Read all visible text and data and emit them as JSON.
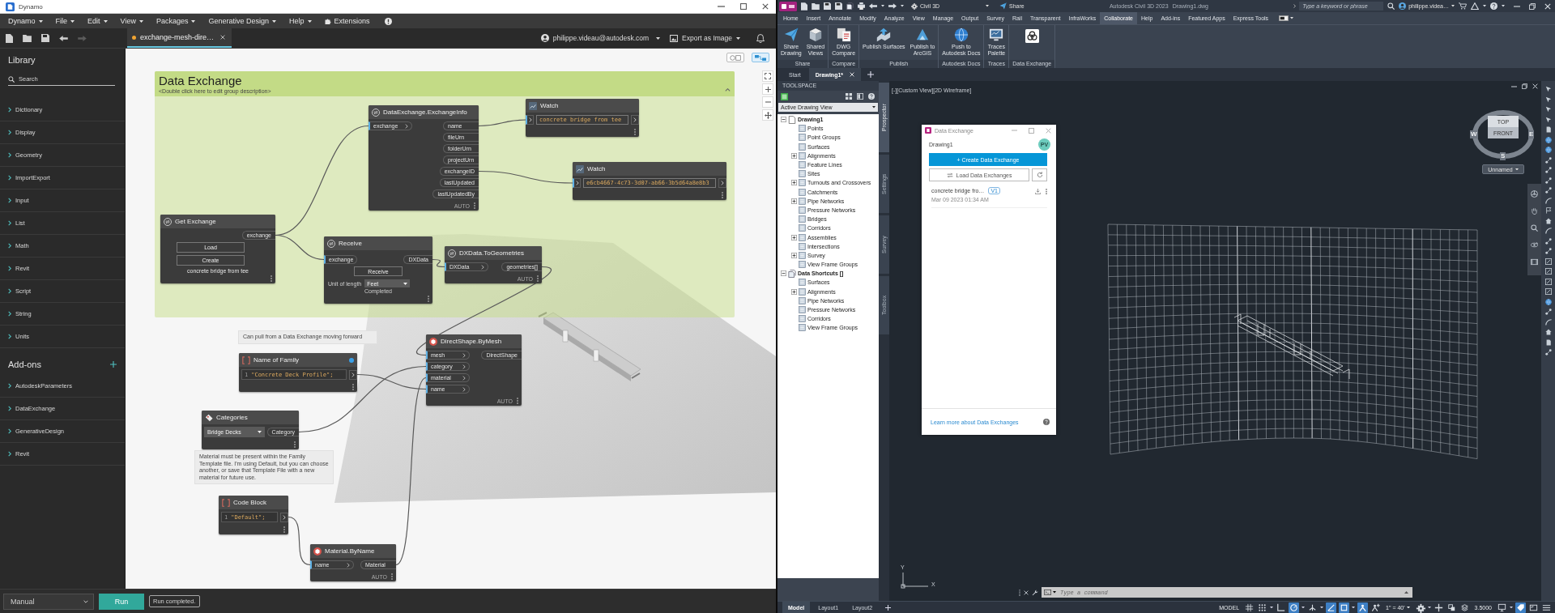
{
  "dynamo": {
    "window": {
      "title": "Dynamo"
    },
    "menu": [
      {
        "kind": "menu",
        "label": "Dynamo"
      },
      {
        "kind": "menu",
        "label": "File"
      },
      {
        "kind": "menu",
        "label": "Edit"
      },
      {
        "kind": "menu",
        "label": "View"
      },
      {
        "kind": "menu",
        "label": "Packages"
      },
      {
        "kind": "menu",
        "label": "Generative Design"
      },
      {
        "kind": "menu",
        "label": "Help"
      },
      {
        "kind": "extensions",
        "label": "Extensions"
      }
    ],
    "toolbar": [
      {
        "kind": "new",
        "disabled": false
      },
      {
        "kind": "open",
        "disabled": false
      },
      {
        "kind": "save",
        "disabled": false
      },
      {
        "kind": "undo",
        "disabled": false
      },
      {
        "kind": "redo",
        "disabled": true
      }
    ],
    "file_tab": {
      "label": "exchange-mesh-dire…",
      "unsaved": true
    },
    "account": "philippe.videau@autodesk.com",
    "export_button": "Export as Image",
    "library": {
      "title": "Library",
      "search": {
        "placeholder": "Search"
      },
      "items": [
        "Dictionary",
        "Display",
        "Geometry",
        "ImportExport",
        "Input",
        "List",
        "Math",
        "Revit",
        "Script",
        "String",
        "Units"
      ],
      "addons_title": "Add-ons",
      "addons": [
        "AutodeskParameters",
        "DataExchange",
        "GenerativeDesign",
        "Revit"
      ]
    },
    "view_toggles": [
      {
        "kind": "geometry",
        "selected": false
      },
      {
        "kind": "graph",
        "selected": true
      }
    ],
    "graph": {
      "group": {
        "title": "Data Exchange",
        "description": "<Double click here to edit group description>"
      },
      "nodes": [
        {
          "kind": "function",
          "title": "DataExchange.ExchangeInfo",
          "inputs": [
            {
              "label": "exchange",
              "connected": true
            }
          ],
          "outputs": [
            "name",
            "fileUrn",
            "folderUrn",
            "projectUrn",
            "exchangeID",
            "lastUpdated",
            "lastUpdatedBy"
          ],
          "lacing": "AUTO",
          "is_input": false
        },
        {
          "kind": "watch",
          "title": "Watch",
          "value": "concrete bridge from tee",
          "connected": true,
          "is_input": false
        },
        {
          "kind": "watch",
          "title": "Watch",
          "value": "e6cb4667-4c73-3d07-ab66-3b5d64a8e8b3",
          "connected": true,
          "is_input": false
        },
        {
          "kind": "get_exchange",
          "title": "Get Exchange",
          "outputs": [
            "exchange"
          ],
          "buttons": [
            "Load",
            "Create"
          ],
          "caption": "concrete bridge from tee",
          "is_input": false
        },
        {
          "kind": "receive",
          "title": "Receive",
          "inputs": [
            {
              "label": "exchange",
              "connected": true
            }
          ],
          "outputs": [
            "DXData"
          ],
          "button": "Receive",
          "unit_label": "Unit of length",
          "unit": "Feet",
          "status": "Completed",
          "is_input": false
        },
        {
          "kind": "function",
          "title": "DXData.ToGeometries",
          "inputs": [
            {
              "label": "DXData",
              "connected": true
            }
          ],
          "outputs": [
            "geometries[]"
          ],
          "lacing": "AUTO",
          "is_input": false
        },
        {
          "kind": "function",
          "title": "DirectShape.ByMesh",
          "inputs": [
            {
              "label": "mesh",
              "connected": true
            },
            {
              "label": "category",
              "connected": true
            },
            {
              "label": "material",
              "connected": true
            },
            {
              "label": "name",
              "connected": true
            }
          ],
          "outputs": [
            "DirectShape"
          ],
          "lacing": "AUTO",
          "is_input": false
        },
        {
          "kind": "code",
          "title": "Name of Family",
          "lines": [
            {
              "number": "1",
              "code": "\"Concrete Deck Profile\";"
            }
          ],
          "is_input": true
        },
        {
          "kind": "dropdown",
          "title": "Categories",
          "value": "Bridge Decks",
          "outputs": [
            "Category"
          ],
          "is_input": false
        },
        {
          "kind": "code",
          "title": "Code Block",
          "lines": [
            {
              "number": "1",
              "code": "\"Default\";"
            }
          ],
          "is_input": false
        },
        {
          "kind": "function",
          "title": "Material.ByName",
          "inputs": [
            {
              "label": "name",
              "connected": true
            }
          ],
          "outputs": [
            "Material"
          ],
          "lacing": "AUTO",
          "is_input": false
        }
      ],
      "notes": [
        {
          "text": "Can pull from a Data Exchange moving forward"
        },
        {
          "text": "Material must be present within the Family Template file. I'm using Default, but you can choose another, or save that Template File with a new material for future use."
        }
      ]
    },
    "run_mode": "Manual",
    "run_button": "Run",
    "run_status": "Run completed."
  },
  "civil3d": {
    "title_bar": {
      "workspace": "Civil 3D",
      "share": "Share",
      "title": "Autodesk Civil 3D 2023",
      "file": "Drawing1.dwg",
      "search": {
        "placeholder": "Type a keyword or phrase"
      },
      "user": "philippe.videa…"
    },
    "ribbon_tabs": [
      {
        "label": "Home",
        "selected": false
      },
      {
        "label": "Insert",
        "selected": false
      },
      {
        "label": "Annotate",
        "selected": false
      },
      {
        "label": "Modify",
        "selected": false
      },
      {
        "label": "Analyze",
        "selected": false
      },
      {
        "label": "View",
        "selected": false
      },
      {
        "label": "Manage",
        "selected": false
      },
      {
        "label": "Output",
        "selected": false
      },
      {
        "label": "Survey",
        "selected": false
      },
      {
        "label": "Rail",
        "selected": false
      },
      {
        "label": "Transparent",
        "selected": false
      },
      {
        "label": "InfraWorks",
        "selected": false
      },
      {
        "label": "Collaborate",
        "selected": true
      },
      {
        "label": "Help",
        "selected": false
      },
      {
        "label": "Add-ins",
        "selected": false
      },
      {
        "label": "Featured Apps",
        "selected": false
      },
      {
        "label": "Express Tools",
        "selected": false
      }
    ],
    "ribbon_panels": [
      {
        "label": "Share",
        "buttons": [
          {
            "kind": "share",
            "label": "Share\nDrawing"
          },
          {
            "kind": "views",
            "label": "Shared\nViews"
          }
        ]
      },
      {
        "label": "Compare",
        "buttons": [
          {
            "kind": "compare",
            "label": "DWG\nCompare"
          }
        ]
      },
      {
        "label": "Publish",
        "buttons": [
          {
            "kind": "surfaces",
            "label": "Publish Surfaces"
          },
          {
            "kind": "arcgis",
            "label": "Publish to\nArcGIS"
          }
        ]
      },
      {
        "label": "Autodesk Docs",
        "buttons": [
          {
            "kind": "docs",
            "label": "Push to\nAutodesk Docs"
          }
        ]
      },
      {
        "label": "Traces",
        "buttons": [
          {
            "kind": "traces",
            "label": "Traces\nPalette"
          }
        ]
      },
      {
        "label": "Data Exchange",
        "buttons": [
          {
            "kind": "exchange"
          }
        ]
      }
    ],
    "file_tabs": [
      {
        "label": "Start",
        "selected": false
      },
      {
        "label": "Drawing1*",
        "selected": true
      }
    ],
    "toolspace": {
      "title": "TOOLSPACE",
      "view": "Active Drawing View",
      "tree": [
        {
          "label": "Drawing1",
          "expanded": true,
          "children": [
            {
              "label": "Points",
              "expandable": false
            },
            {
              "label": "Point Groups",
              "expandable": false
            },
            {
              "label": "Surfaces",
              "expandable": false
            },
            {
              "label": "Alignments",
              "expandable": true
            },
            {
              "label": "Feature Lines",
              "expandable": false
            },
            {
              "label": "Sites",
              "expandable": false
            },
            {
              "label": "Turnouts and Crossovers",
              "expandable": true
            },
            {
              "label": "Catchments",
              "expandable": false
            },
            {
              "label": "Pipe Networks",
              "expandable": true
            },
            {
              "label": "Pressure Networks",
              "expandable": false
            },
            {
              "label": "Bridges",
              "expandable": false
            },
            {
              "label": "Corridors",
              "expandable": false
            },
            {
              "label": "Assemblies",
              "expandable": true
            },
            {
              "label": "Intersections",
              "expandable": false
            },
            {
              "label": "Survey",
              "expandable": true
            },
            {
              "label": "View Frame Groups",
              "expandable": false
            }
          ]
        },
        {
          "label": "Data Shortcuts []",
          "expanded": true,
          "children": [
            {
              "label": "Surfaces",
              "expandable": false
            },
            {
              "label": "Alignments",
              "expandable": true
            },
            {
              "label": "Pipe Networks",
              "expandable": false
            },
            {
              "label": "Pressure Networks",
              "expandable": false
            },
            {
              "label": "Corridors",
              "expandable": false
            },
            {
              "label": "View Frame Groups",
              "expandable": false
            }
          ]
        }
      ],
      "side_tabs": [
        {
          "label": "Prospector",
          "selected": true
        },
        {
          "label": "Settings",
          "selected": false
        },
        {
          "label": "Survey",
          "selected": false
        },
        {
          "label": "Toolbox",
          "selected": false
        }
      ]
    },
    "viewport": {
      "label": "[-][Custom View][2D Wireframe]",
      "viewcube": {
        "faces": [
          "TOP",
          "FRONT"
        ],
        "compass": [
          "W",
          "E",
          "S"
        ],
        "view_name": "Unnamed"
      }
    },
    "data_exchange": {
      "title": "Data Exchange",
      "drawing": "Drawing1",
      "avatar": "PV",
      "create_button": "+ Create Data Exchange",
      "load_button": "Load Data Exchanges",
      "exchanges": [
        {
          "name": "concrete bridge fro…",
          "version": "V1",
          "date": "Mar 09 2023 01:34 AM"
        }
      ],
      "footer_link": "Learn more about Data Exchanges"
    },
    "ucs": {
      "x_label": "X",
      "y_label": "Y"
    },
    "command_line": {
      "placeholder": "Type a command"
    },
    "layout_tabs": [
      {
        "label": "Model",
        "selected": true
      },
      {
        "label": "Layout1",
        "selected": false
      },
      {
        "label": "Layout2",
        "selected": false
      }
    ],
    "status_bar": {
      "mode": "MODEL",
      "toggles": [
        {
          "kind": "grid",
          "on": false
        },
        {
          "kind": "snap",
          "on": false
        },
        {
          "kind": "ortho",
          "on": false
        },
        {
          "kind": "polar",
          "on": true
        },
        {
          "kind": "isodraft",
          "on": false
        },
        {
          "kind": "tracking",
          "on": true
        },
        {
          "kind": "osnap",
          "on": true
        },
        {
          "kind": "annovis",
          "on": true
        },
        {
          "kind": "autoscale",
          "on": false
        }
      ],
      "scale": "1\" = 40'",
      "tools": [
        {
          "kind": "gear",
          "on": false
        },
        {
          "kind": "plus",
          "on": false
        },
        {
          "kind": "isolate",
          "on": false
        },
        {
          "kind": "layers",
          "on": false
        }
      ],
      "value": "3.5000",
      "tools_end": [
        {
          "kind": "monitor",
          "on": false
        },
        {
          "kind": "tag",
          "on": true
        },
        {
          "kind": "fullscreen",
          "on": false
        },
        {
          "kind": "menu",
          "on": false
        }
      ]
    }
  }
}
